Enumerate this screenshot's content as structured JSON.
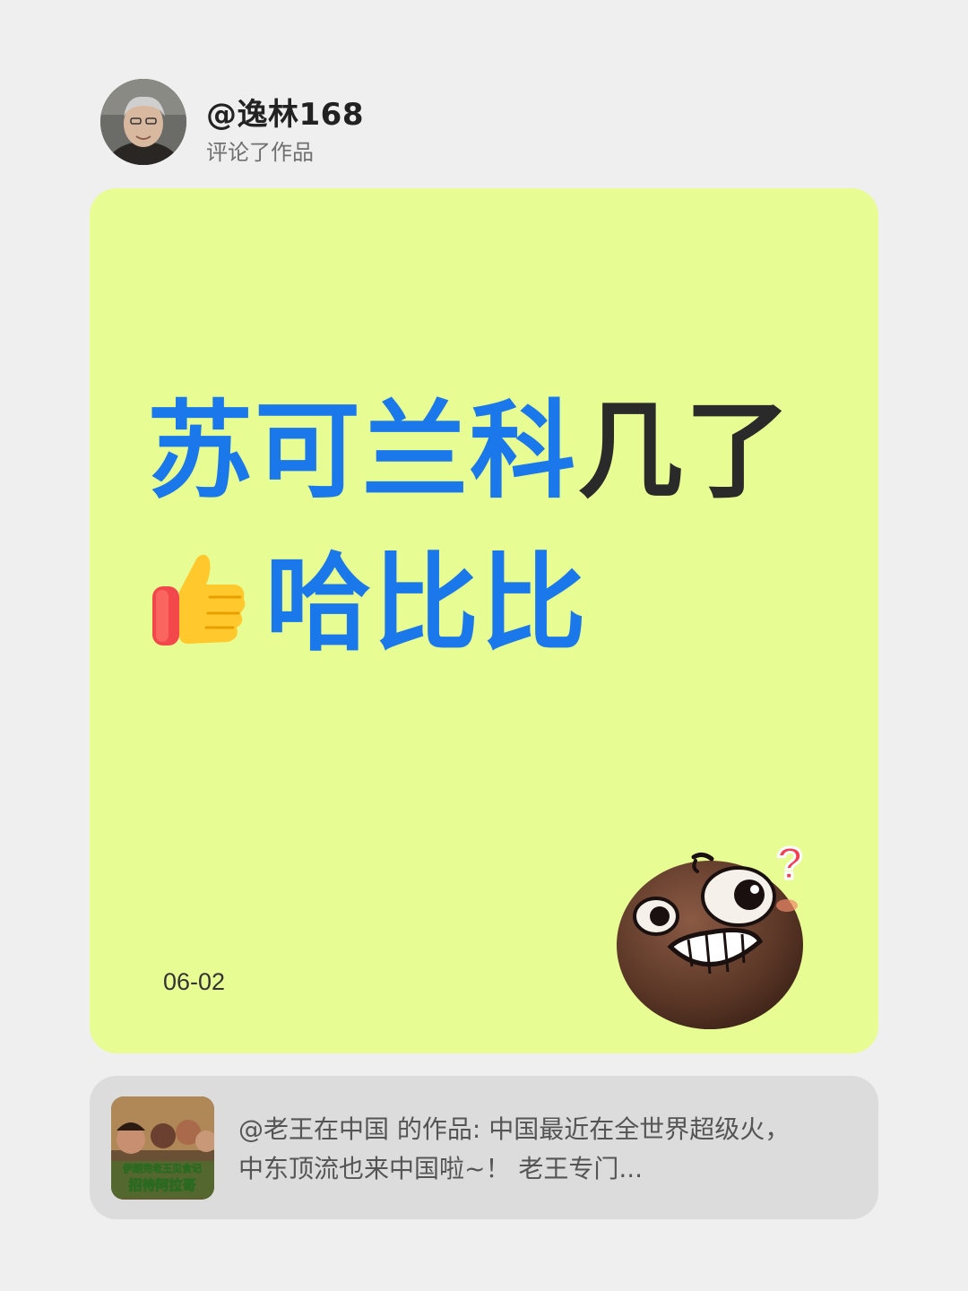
{
  "header": {
    "username": "@逸林168",
    "action_text": "评论了作品"
  },
  "comment": {
    "line1_blue": "苏可兰科",
    "line1_dark": "几了",
    "thumb_icon": "thumbs-up-emoji",
    "line2": "哈比比",
    "date": "06-02",
    "sticker_icon": "confused-grin-sticker"
  },
  "referenced_work": {
    "text": "@老王在中国 的作品: 中国最近在全世界超级火，中东顶流也来中国啦~！ 老王专门...",
    "thumb_caption_top": "伊朗完老王见食记",
    "thumb_caption_bottom": "招待阿拉哥"
  },
  "colors": {
    "background": "#efefef",
    "card": "#e7fc92",
    "blue_text": "#1b78ea",
    "dark_text": "#2a2a2a",
    "ref_card": "#dcdcdc"
  }
}
